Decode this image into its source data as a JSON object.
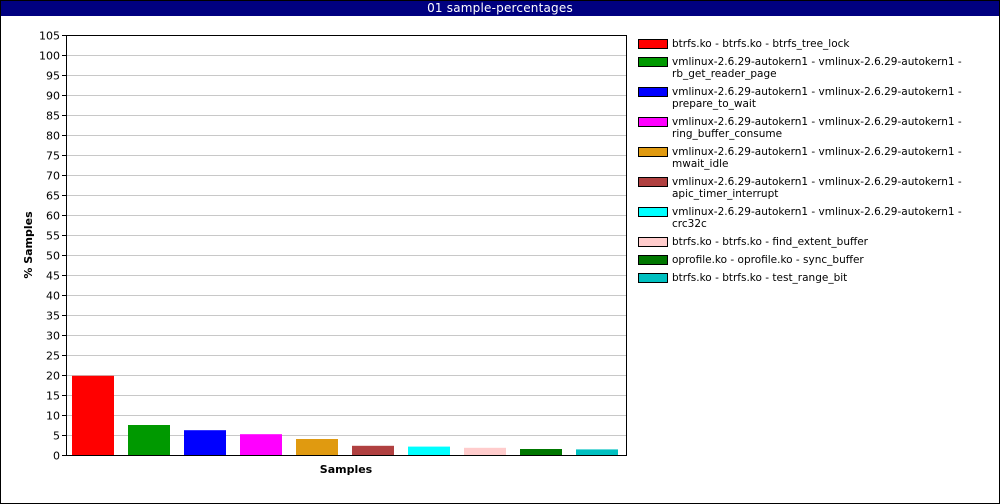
{
  "window": {
    "title": "01 sample-percentages"
  },
  "chart_data": {
    "type": "bar",
    "title": "01 sample-percentages",
    "xlabel": "Samples",
    "ylabel": "% Samples",
    "ylim": [
      0,
      105
    ],
    "ytick_step": 5,
    "grid": true,
    "legend_position": "right",
    "series": [
      {
        "name": "btrfs.ko - btrfs.ko - btrfs_tree_lock",
        "value": 19.8,
        "color": "#ff0000"
      },
      {
        "name": "vmlinux-2.6.29-autokern1 - vmlinux-2.6.29-autokern1 - rb_get_reader_page",
        "value": 7.5,
        "color": "#009900"
      },
      {
        "name": "vmlinux-2.6.29-autokern1 - vmlinux-2.6.29-autokern1 - prepare_to_wait",
        "value": 6.2,
        "color": "#0000ff"
      },
      {
        "name": "vmlinux-2.6.29-autokern1 - vmlinux-2.6.29-autokern1 - ring_buffer_consume",
        "value": 5.2,
        "color": "#ff00ff"
      },
      {
        "name": "vmlinux-2.6.29-autokern1 - vmlinux-2.6.29-autokern1 - mwait_idle",
        "value": 4.0,
        "color": "#e09a10"
      },
      {
        "name": "vmlinux-2.6.29-autokern1 - vmlinux-2.6.29-autokern1 - apic_timer_interrupt",
        "value": 2.3,
        "color": "#b04040"
      },
      {
        "name": "vmlinux-2.6.29-autokern1 - vmlinux-2.6.29-autokern1 - crc32c",
        "value": 2.1,
        "color": "#00ffff"
      },
      {
        "name": "btrfs.ko - btrfs.ko - find_extent_buffer",
        "value": 1.8,
        "color": "#ffcccc"
      },
      {
        "name": "oprofile.ko - oprofile.ko - sync_buffer",
        "value": 1.5,
        "color": "#007700"
      },
      {
        "name": "btrfs.ko - btrfs.ko - test_range_bit",
        "value": 1.4,
        "color": "#00c0c0"
      }
    ]
  }
}
